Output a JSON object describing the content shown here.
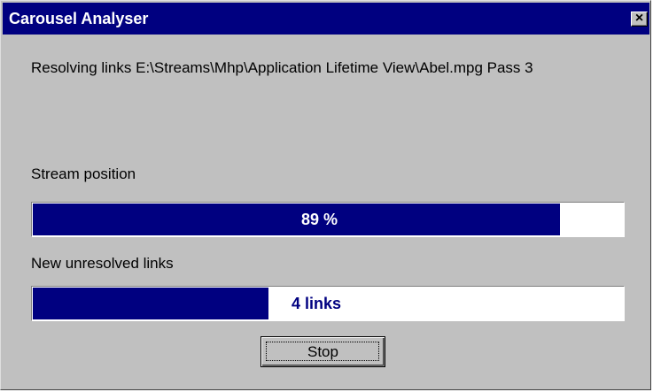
{
  "window": {
    "title": "Carousel Analyser",
    "close_label": "×"
  },
  "status": {
    "text": "Resolving links E:\\Streams\\Mhp\\Application Lifetime View\\Abel.mpg Pass 3"
  },
  "stream_position": {
    "label": "Stream position",
    "percent": 89,
    "display": "89 %"
  },
  "unresolved_links": {
    "label": "New unresolved links",
    "display": "4 links",
    "fill_fraction": 0.4
  },
  "buttons": {
    "stop_label": "Stop"
  },
  "colors": {
    "titlebar": "#000080",
    "progress_fill": "#000080",
    "dialog_bg": "#c0c0c0"
  }
}
